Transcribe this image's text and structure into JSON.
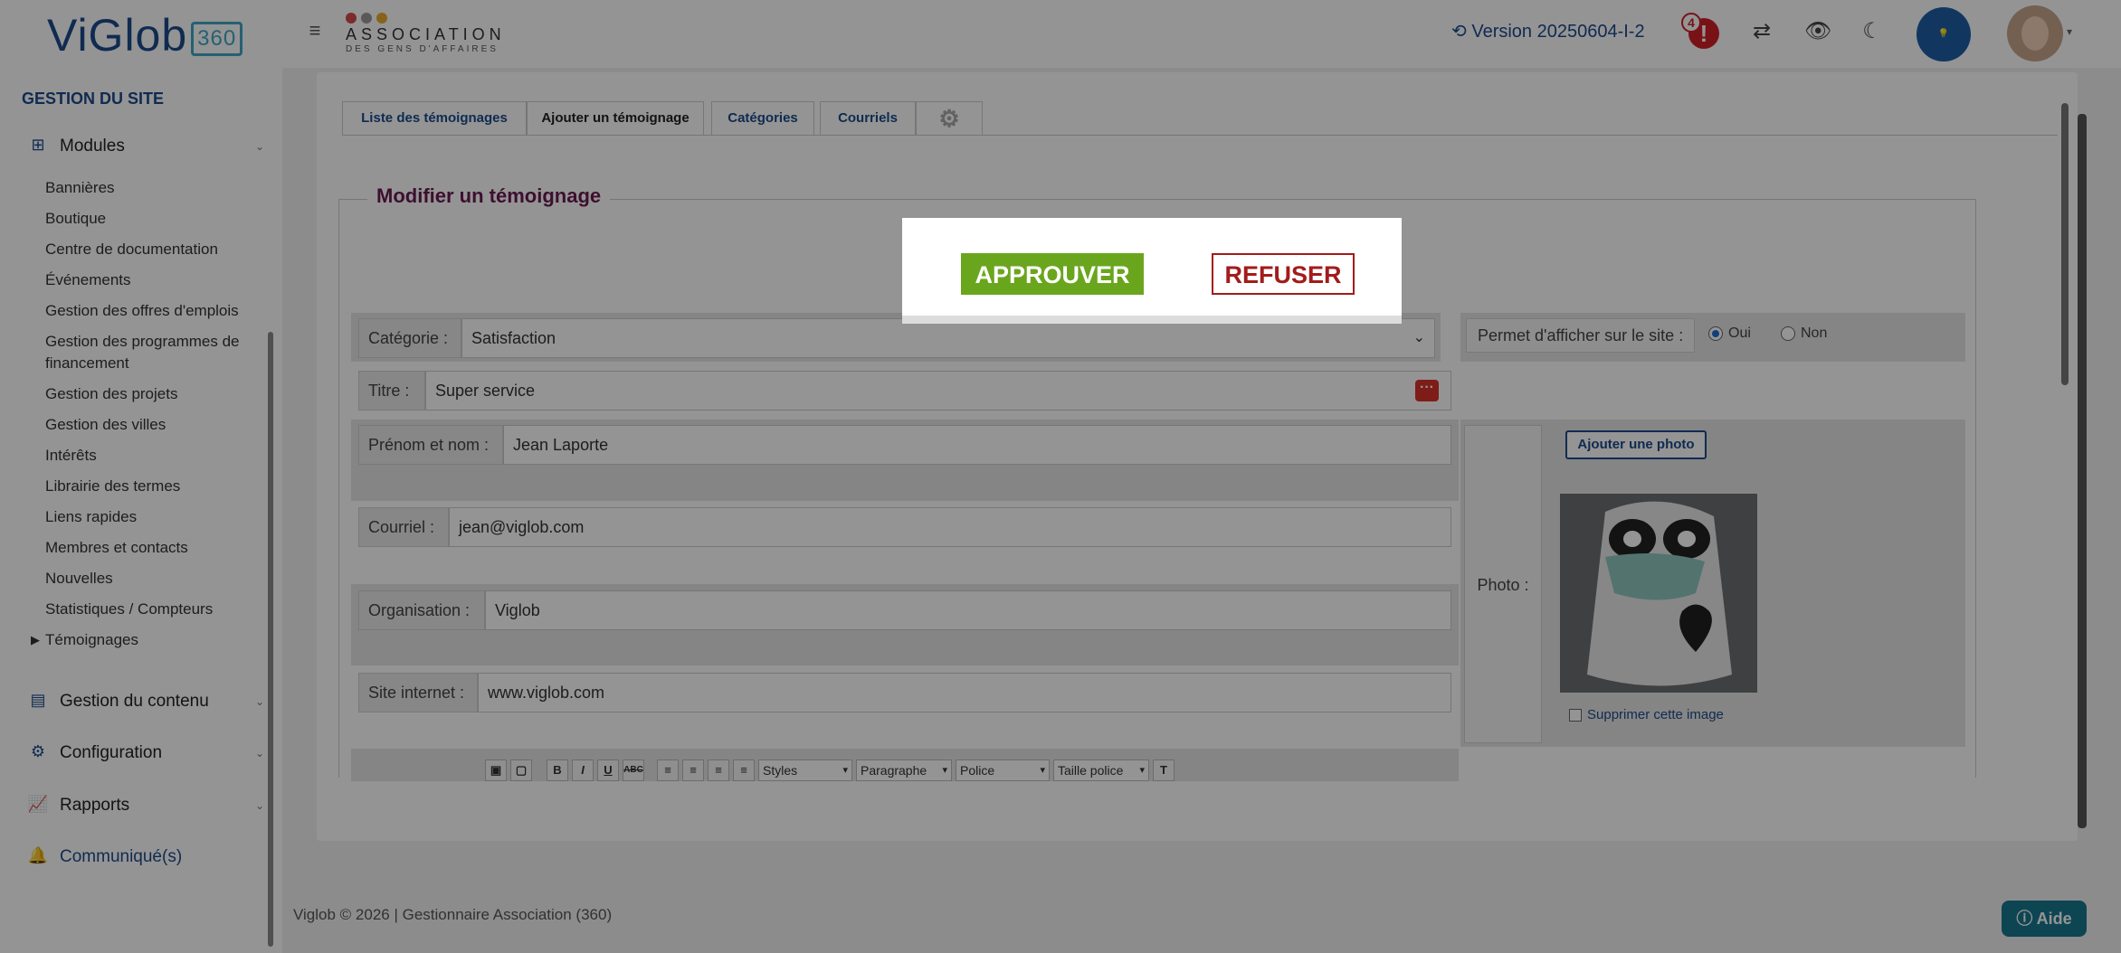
{
  "header": {
    "brand": "ViGlob",
    "brand_badge": "360",
    "assoc_name": "ASSOCIATION",
    "assoc_sub": "DES GENS D'AFFAIRES",
    "version": "Version 20250604-I-2",
    "notification_count": "4",
    "notification_symbol": "!"
  },
  "sidebar": {
    "section_title": "GESTION DU SITE",
    "modules_label": "Modules",
    "module_items": [
      "Bannières",
      "Boutique",
      "Centre de documentation",
      "Événements",
      "Gestion des offres d'emplois",
      "Gestion des programmes de financement",
      "Gestion des projets",
      "Gestion des villes",
      "Intérêts",
      "Librairie des termes",
      "Liens rapides",
      "Membres et contacts",
      "Nouvelles",
      "Statistiques / Compteurs",
      "Témoignages"
    ],
    "content_label": "Gestion du contenu",
    "config_label": "Configuration",
    "reports_label": "Rapports",
    "communique_label": "Communiqué(s)"
  },
  "tabs": [
    "Liste des témoignages",
    "Ajouter un témoignage",
    "Catégories",
    "Courriels"
  ],
  "form": {
    "legend": "Modifier un témoignage",
    "category_label": "Catégorie :",
    "category_value": "Satisfaction",
    "title_label": "Titre :",
    "title_value": "Super service",
    "name_label": "Prénom et nom :",
    "name_value": "Jean Laporte",
    "email_label": "Courriel :",
    "email_value": "jean@viglob.com",
    "org_label": "Organisation :",
    "org_value": "Viglob",
    "site_label": "Site internet :",
    "site_value": "www.viglob.com",
    "permit_label": "Permet d'afficher sur le site :",
    "permit_yes": "Oui",
    "permit_no": "Non",
    "photo_label": "Photo :",
    "add_photo": "Ajouter une photo",
    "delete_image": "Supprimer cette image"
  },
  "editor": {
    "styles": "Styles",
    "paragraph": "Paragraphe",
    "font": "Police",
    "font_size": "Taille police"
  },
  "modal": {
    "approve": "APPROUVER",
    "refuse": "REFUSER"
  },
  "footer": {
    "text": "Viglob © 2026 | Gestionnaire Association (360)",
    "help": "Aide"
  },
  "colors": {
    "brand_blue": "#1c4b8c",
    "approve_green": "#6aa61d",
    "refuse_red": "#a31b1b",
    "legend_purple": "#6a1b52"
  }
}
